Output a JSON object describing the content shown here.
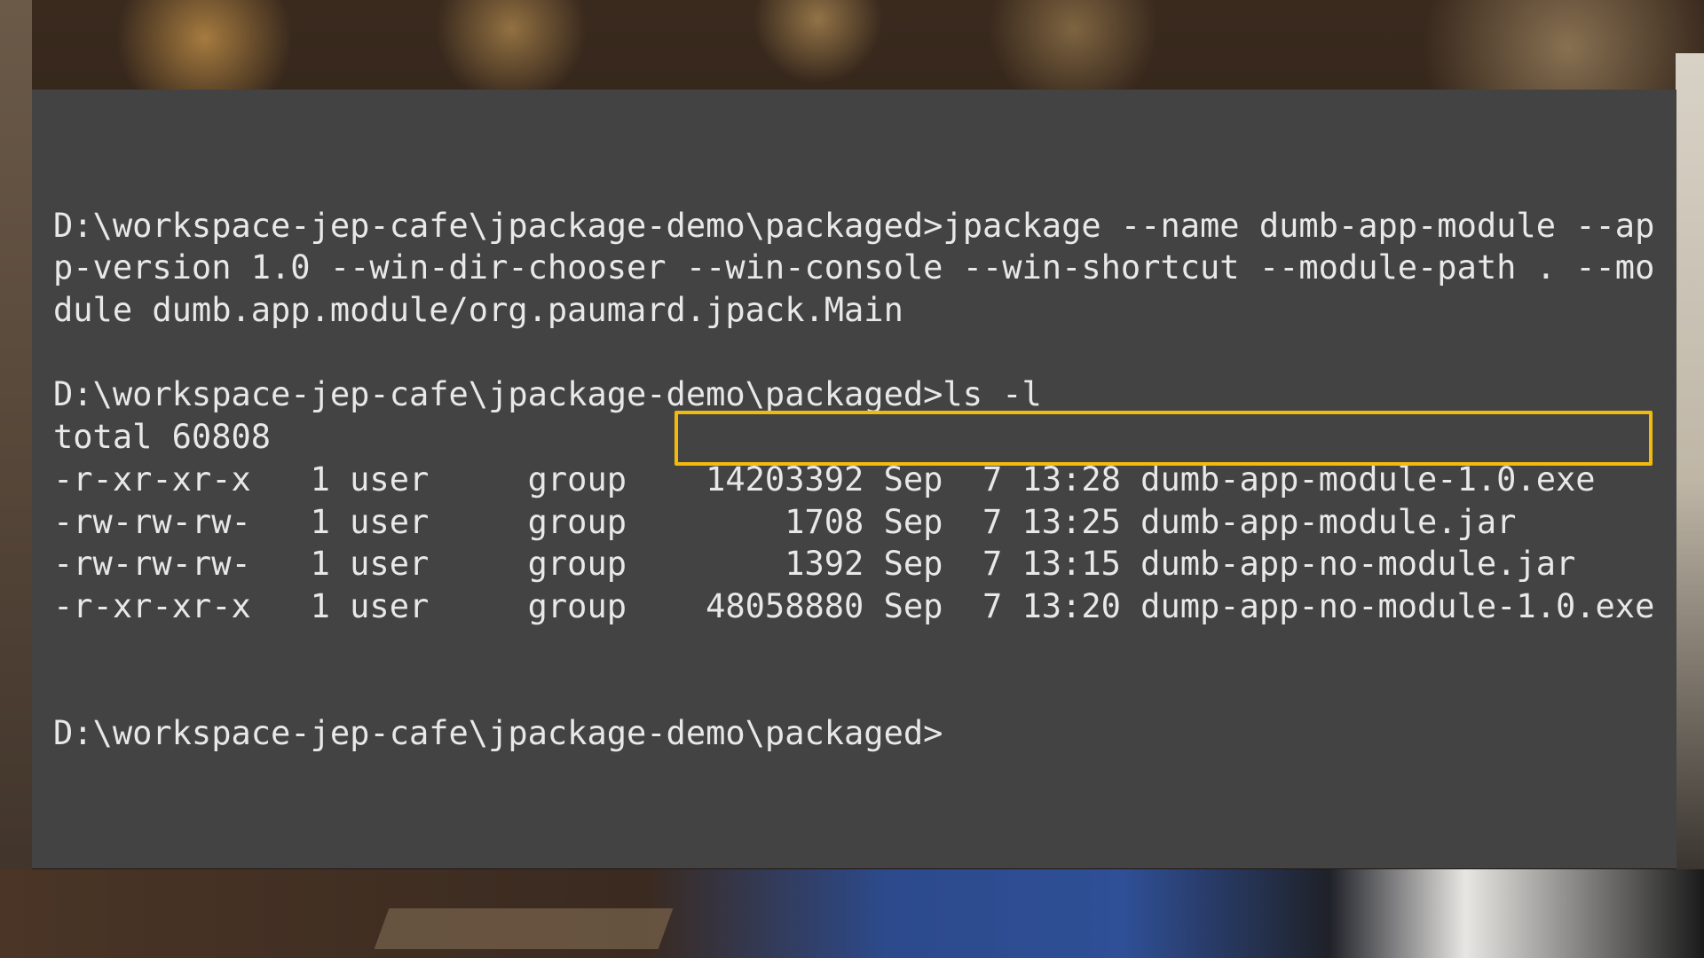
{
  "terminal": {
    "lines": [
      "",
      "D:\\workspace-jep-cafe\\jpackage-demo\\packaged>jpackage --name dumb-app-module --ap",
      "p-version 1.0 --win-dir-chooser --win-console --win-shortcut --module-path . --mo",
      "dule dumb.app.module/org.paumard.jpack.Main",
      "",
      "D:\\workspace-jep-cafe\\jpackage-demo\\packaged>ls -l",
      "total 60808",
      "-r-xr-xr-x   1 user     group    14203392 Sep  7 13:28 dumb-app-module-1.0.exe",
      "-rw-rw-rw-   1 user     group        1708 Sep  7 13:25 dumb-app-module.jar",
      "-rw-rw-rw-   1 user     group        1392 Sep  7 13:15 dumb-app-no-module.jar",
      "-r-xr-xr-x   1 user     group    48058880 Sep  7 13:20 dump-app-no-module-1.0.exe",
      "",
      "",
      "D:\\workspace-jep-cafe\\jpackage-demo\\packaged>"
    ],
    "highlight_color": "#f2b90f",
    "background_color": "#434343",
    "text_color": "#e8e8e8"
  }
}
